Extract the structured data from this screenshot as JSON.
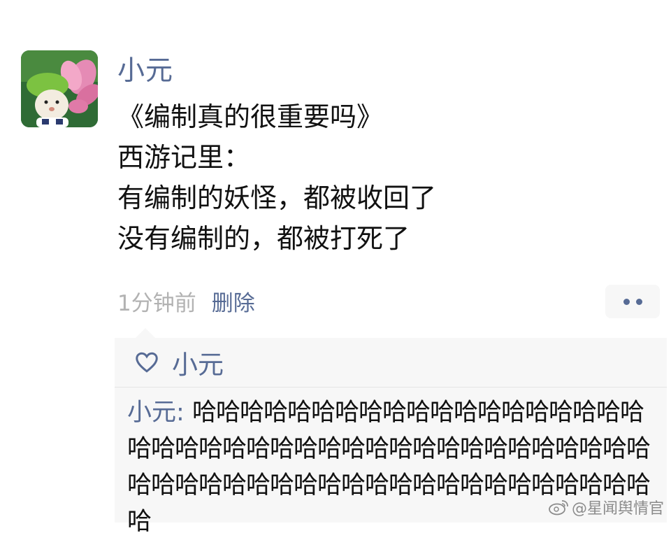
{
  "post": {
    "author": "小元",
    "lines": [
      "《编制真的很重要吗》",
      "西游记里：",
      "有编制的妖怪，都被收回了",
      "没有编制的，都被打死了"
    ],
    "time": "1分钟前",
    "delete_label": "删除",
    "more_icon": "more-dots-icon"
  },
  "likes": {
    "icon": "heart-icon",
    "names": "小元"
  },
  "comment": {
    "author": "小元",
    "separator": ": ",
    "text": "哈哈哈哈哈哈哈哈哈哈哈哈哈哈哈哈哈哈哈哈哈哈哈哈哈哈哈哈哈哈哈哈哈哈哈哈哈哈哈哈哈哈哈哈哈哈哈哈哈哈哈哈哈哈哈哈哈哈哈哈哈哈哈哈"
  },
  "watermark": {
    "icon": "weibo-icon",
    "text": "@星闻舆情官"
  },
  "colors": {
    "link": "#576b95",
    "meta": "#b2b2b2",
    "panel_bg": "#f7f7f7"
  }
}
